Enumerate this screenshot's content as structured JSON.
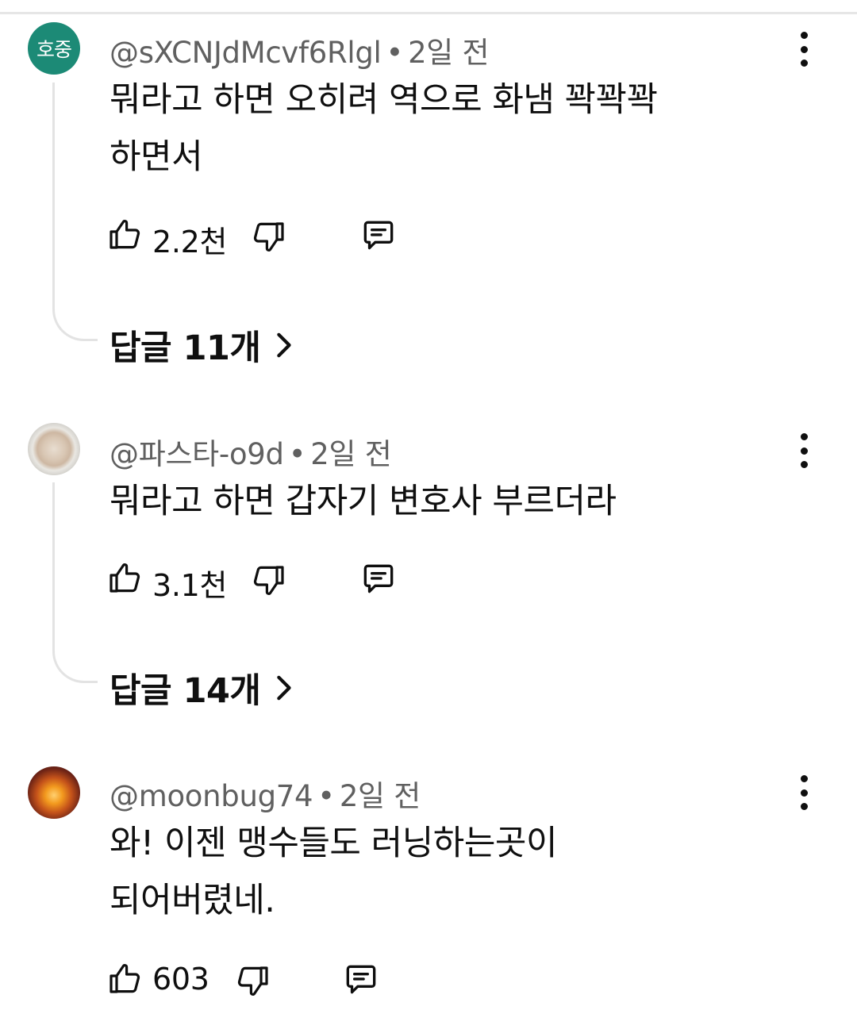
{
  "comments": [
    {
      "avatar_text": "호중",
      "handle": "@sXCNJdMcvf6Rlgl",
      "separator": "•",
      "time": "2일 전",
      "text_lines": [
        "뭐라고 하면 오히려 역으로 화냄 꽉꽉꽉",
        "하면서"
      ],
      "likes": "2.2천",
      "replies_label": "답글 11개"
    },
    {
      "avatar_text": "",
      "handle": "@파스타-o9d",
      "separator": "•",
      "time": "2일 전",
      "text_lines": [
        "뭐라고 하면 갑자기 변호사 부르더라"
      ],
      "likes": "3.1천",
      "replies_label": "답글 14개"
    },
    {
      "avatar_text": "",
      "handle": "@moonbug74",
      "separator": "•",
      "time": "2일 전",
      "text_lines": [
        "와! 이젠 맹수들도 러닝하는곳이",
        "되어버렸네."
      ],
      "likes": "603"
    }
  ],
  "icons": {
    "like": "thumbs-up-icon",
    "dislike": "thumbs-down-icon",
    "reply": "comment-reply-icon",
    "more": "more-vertical-icon",
    "chevron": "chevron-right-icon"
  },
  "colors": {
    "avatar_initials_bg": "#1c8a76",
    "meta_text": "#606060",
    "primary_text": "#0f0f0f",
    "thread_line": "#e3e3e3"
  }
}
